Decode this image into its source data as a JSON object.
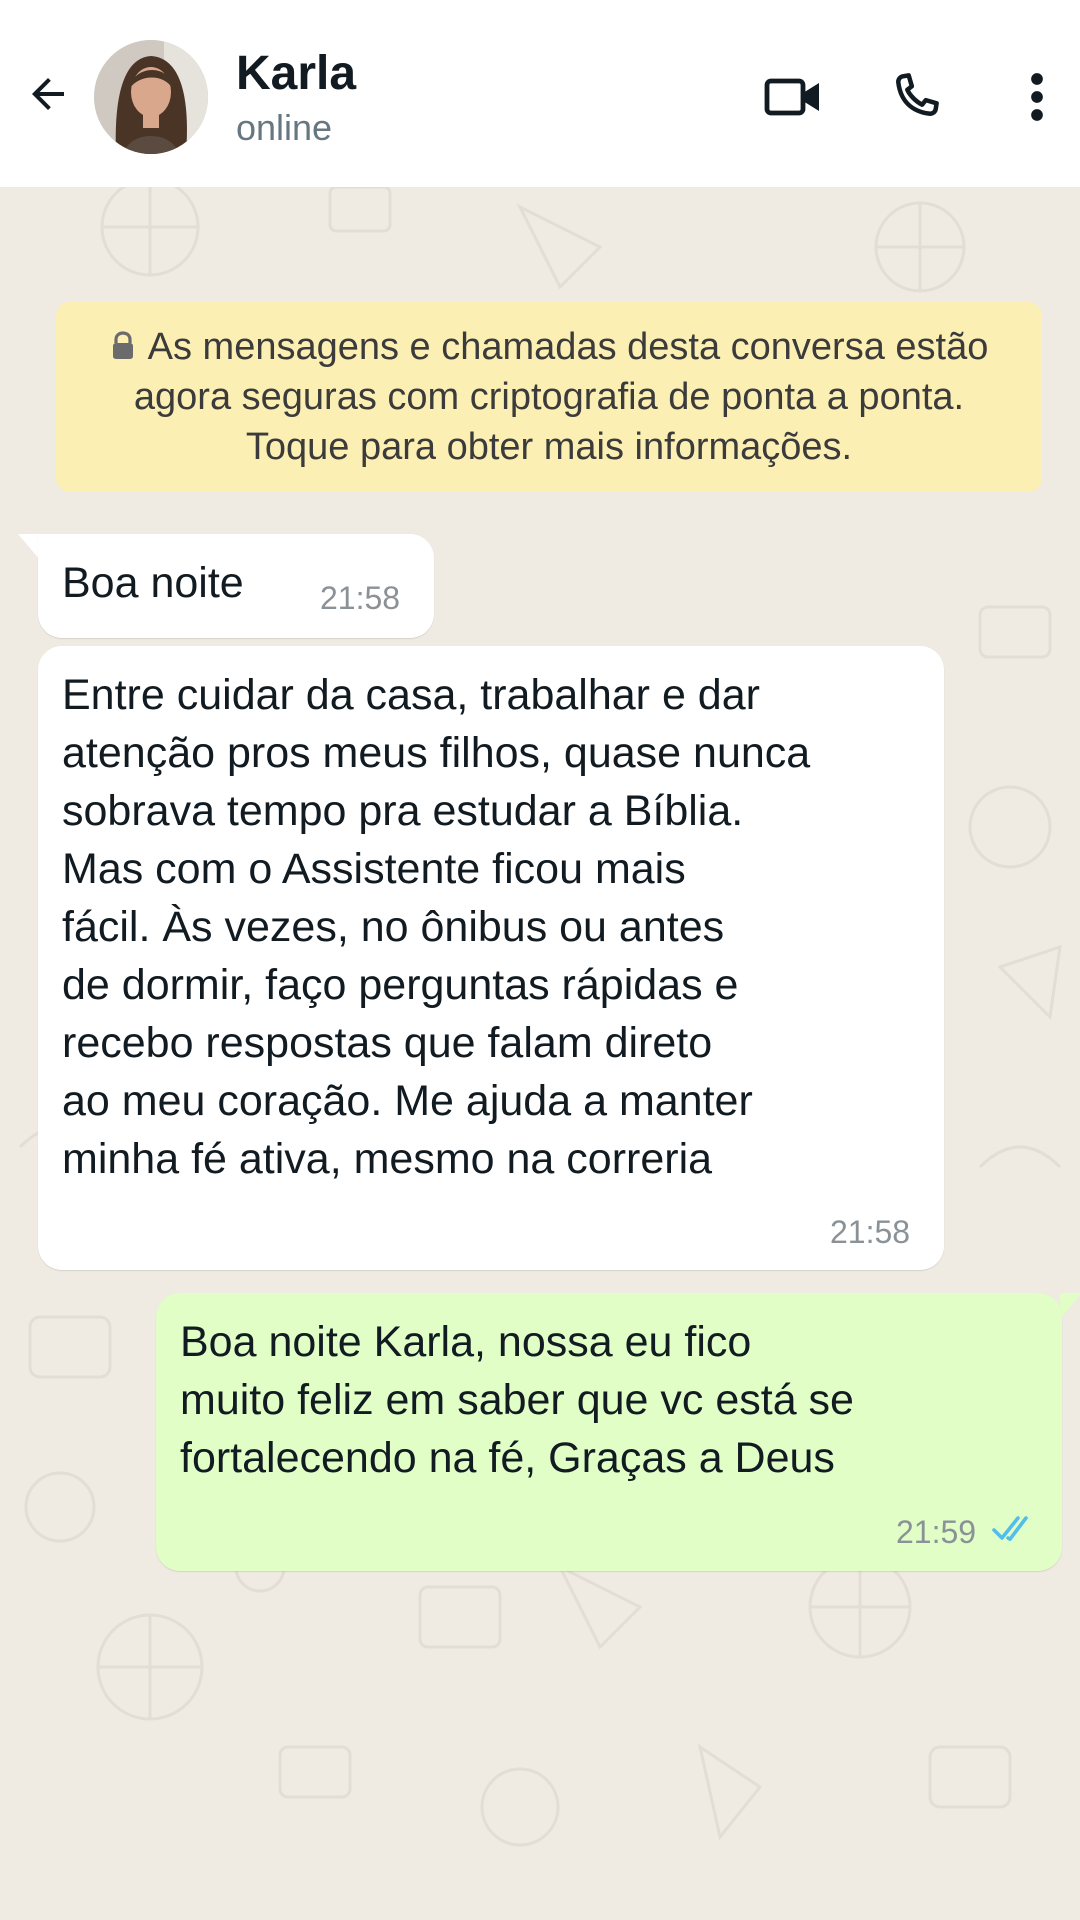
{
  "header": {
    "contact_name": "Karla",
    "status": "online",
    "icons": [
      "back-arrow-icon",
      "video-call-icon",
      "phone-call-icon",
      "more-options-icon"
    ]
  },
  "notice": {
    "text": "As mensagens e chamadas desta conversa estão agora seguras com criptografia de ponta a ponta. Toque para obter mais informações.",
    "icon": "lock-icon",
    "background": "#fcefb4"
  },
  "messages": [
    {
      "direction": "incoming",
      "text": "Boa noite",
      "time": "21:58"
    },
    {
      "direction": "incoming",
      "text": "Entre cuidar da casa, trabalhar e dar\natenção pros meus filhos, quase nunca\nsobrava tempo pra estudar a Bíblia.\nMas com o Assistente ficou mais\nfácil. Às vezes, no ônibus ou antes\nde dormir, faço perguntas rápidas e\nrecebo respostas que falam direto\nao meu coração. Me ajuda a manter\nminha fé ativa, mesmo na correria",
      "time": "21:58"
    },
    {
      "direction": "outgoing",
      "text": "Boa noite Karla, nossa eu fico\nmuito feliz em saber que vc está se\nfortalecendo na fé, Graças a Deus",
      "time": "21:59",
      "status_icon": "read-double-check-icon"
    }
  ],
  "colors": {
    "chat_background": "#efeae2",
    "incoming_bubble": "#ffffff",
    "outgoing_bubble": "#e1fec6",
    "read_ticks": "#53bdeb"
  }
}
